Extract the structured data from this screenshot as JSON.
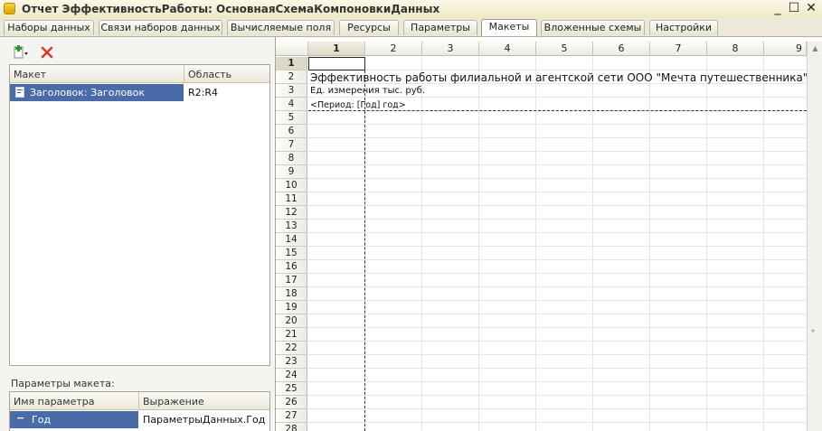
{
  "window": {
    "title": "Отчет ЭффективностьРаботы: ОсновнаяСхемаКомпоновкиДанных",
    "controls": {
      "minimize": "_",
      "maximize": "☐",
      "close": "✕"
    }
  },
  "tabs": [
    {
      "label": "Наборы данных",
      "active": false
    },
    {
      "label": "Связи наборов данных",
      "active": false
    },
    {
      "label": "Вычисляемые поля",
      "active": false
    },
    {
      "label": "Ресурсы",
      "active": false
    },
    {
      "label": "Параметры",
      "active": false
    },
    {
      "label": "Макеты",
      "active": true
    },
    {
      "label": "Вложенные схемы",
      "active": false
    },
    {
      "label": "Настройки",
      "active": false
    }
  ],
  "toolbar": {
    "add_icon": "add-icon",
    "delete_icon": "delete-icon"
  },
  "layouts_table": {
    "columns": [
      "Макет",
      "Область"
    ],
    "rows": [
      {
        "layout": "Заголовок: Заголовок",
        "area": "R2:R4"
      }
    ]
  },
  "params_section": {
    "label": "Параметры макета:",
    "columns": [
      "Имя параметра",
      "Выражение"
    ],
    "rows": [
      {
        "name": "Год",
        "expression": "ПараметрыДанных.Год"
      }
    ]
  },
  "sheet": {
    "column_headers": [
      "1",
      "2",
      "3",
      "4",
      "5",
      "6",
      "7",
      "8",
      "9"
    ],
    "row_headers": [
      "1",
      "2",
      "3",
      "4",
      "5",
      "6",
      "7",
      "8",
      "9",
      "10",
      "11",
      "12",
      "13",
      "14",
      "15",
      "16",
      "17",
      "18",
      "19",
      "20",
      "21",
      "22",
      "23",
      "24",
      "25",
      "26",
      "27",
      "28"
    ],
    "selected_column": "1",
    "selected_row": "1",
    "cells": {
      "r2": "Эффективность работы филиальной и агентской сети ООО \"Мечта путешественника\"",
      "r3": "Ед. измерения тыс. руб.",
      "r4": "<Период: [Год] год>"
    }
  },
  "colors": {
    "selection": "#4b6aa8",
    "active_tab": "#ffffff"
  }
}
